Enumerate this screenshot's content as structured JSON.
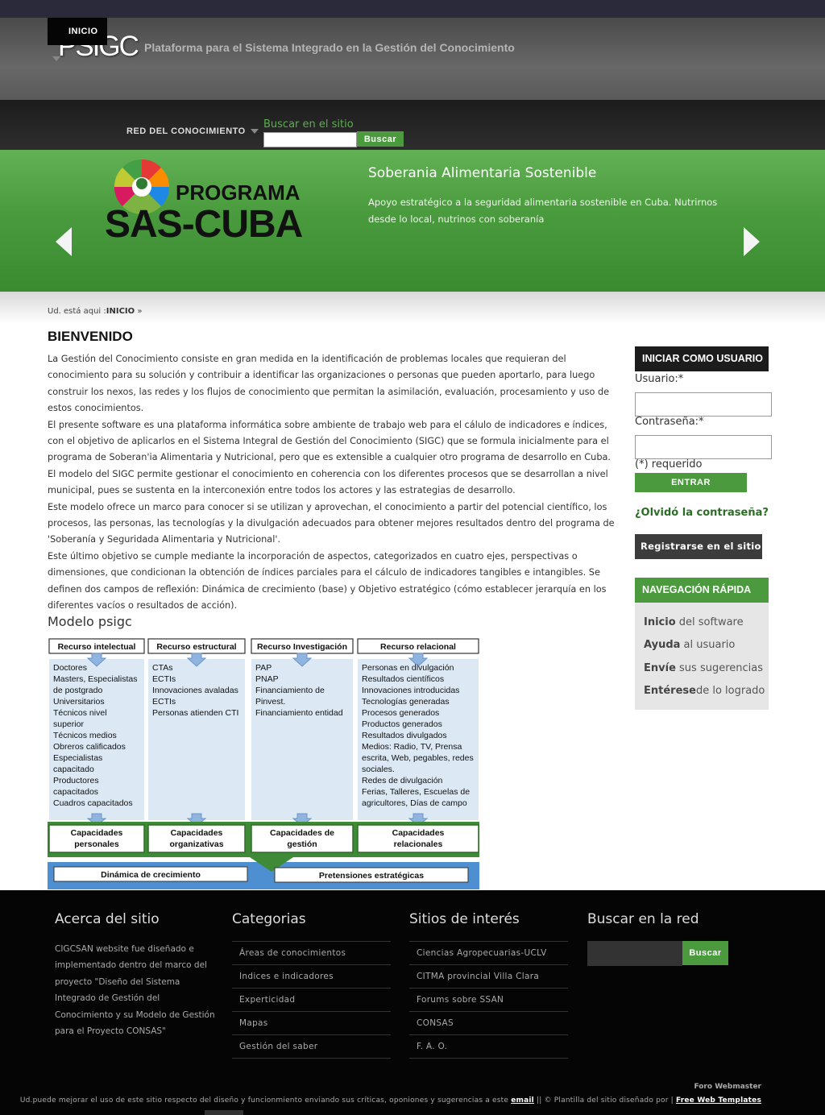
{
  "header": {
    "logo": "PSIGC",
    "tagline": "Plataforma para el Sistema Integrado en la Gestión del Conocimiento"
  },
  "nav": {
    "items": [
      {
        "label": "INICIO"
      },
      {
        "label": "RED DEL CONOCIMIENTO"
      }
    ],
    "search_label": "Buscar en el sitio",
    "search_value": "",
    "search_button": "Buscar"
  },
  "banner": {
    "logo_line1": "PROGRAMA",
    "logo_line2": "SAS-CUBA",
    "title": "Soberania Alimentaria Sostenible",
    "text": "Apoyo estratégico a la seguridad alimentaria sostenible en Cuba. Nutrirnos desde lo local, nutrinos con soberanía"
  },
  "breadcrumb": {
    "prefix": "Ud. está aqui :",
    "current": "INICIO",
    "suffix": " »"
  },
  "main": {
    "title": "BIENVENIDO",
    "paragraphs": [
      "La Gestión del Conocimiento consiste en gran medida en la identificación de problemas locales que requieran del conocimiento para su solución y contribuir a identificar las organizaciones o personas que pueden aportarlo, para luego construir los nexos, las redes y los flujos de conocimiento que permitan la asimilación, evaluación, procesamiento y uso de estos conocimientos.",
      "El presente software es una plataforma informática sobre ambiente de trabajo web para el cálulo de indicadores e índices, con el objetivo de aplicarlos en el Sistema Integral de Gestión del Conocimiento (SIGC) que se formula inicialmente para el programa de Soberan'ia Alimentaria y Nutricional, pero que es extensible a cualquier otro programa de desarrollo en Cuba.",
      "El modelo del SIGC permite gestionar el conocimiento en coherencia con los diferentes procesos que se desarrollan a nivel municipal, pues se sustenta en la interconexión entre todos los actores y las estrategias de desarrollo.",
      "Este modelo ofrece un marco para conocer si se utilizan y aprovechan, el conocimiento a partir del potencial científico, los procesos, las personas, las tecnologías y la divulgación adecuados para obtener mejores resultados dentro del programa de 'Soberanía y Seguridada Alimentaria y Nutricional'.",
      "Este último objetivo se cumple mediante la incorporación de aspectos, categorizados en cuatro ejes, perspectivas o dimensiones, que condicionan la obtención de índices parciales para el cálculo de indicadores tangibles e intangibles. Se definen dos campos de reflexión: Dinámica de crecimiento (base) y Objetivo estratégico (cómo establecer jerarquía en los diferentes vacíos o resultados de acción)."
    ],
    "model_title": "Modelo psigc"
  },
  "diagram": {
    "columns": [
      {
        "header": "Recurso intelectual",
        "items": [
          "Doctores",
          "Masters, Especialistas",
          "de postgrado",
          "Universitarios",
          "Técnicos nivel",
          "superior",
          "Técnicos medios",
          "Obreros calificados",
          "Especialistas",
          "capacitado",
          "Productores",
          "capacitados",
          "Cuadros capacitados"
        ],
        "footer": [
          "Capacidades",
          "personales"
        ]
      },
      {
        "header": "Recurso estructural",
        "items": [
          "CTAs",
          "ECTIs",
          "Innovaciones avaladas",
          "ECTIs",
          "Personas atienden CTI"
        ],
        "footer": [
          "Capacidades",
          "organizativas"
        ]
      },
      {
        "header": "Recurso Investigación",
        "items": [
          "PAP",
          "PNAP",
          "Financiamiento de",
          "Pinvest.",
          "Financiamiento entidad"
        ],
        "footer": [
          "Capacidades  de",
          "gestión"
        ]
      },
      {
        "header": "Recurso relacional",
        "items": [
          "Personas en divulgación",
          "Resultados científicos",
          "Innovaciones introducidas",
          "Tecnologías generadas",
          "Procesos generados",
          "Productos generados",
          "Resultados divulgados",
          "Medios: Radio, TV, Prensa",
          "escrita, Web, pegables, redes",
          "sociales.",
          "Redes de divulgación",
          "Ferias, Talleres, Escuelas de",
          "agricultores, Días de campo"
        ],
        "footer": [
          "Capacidades",
          "relacionales"
        ]
      }
    ],
    "bottom_left": "Dinámica de crecimiento",
    "bottom_right": "Pretensiones estratégicas"
  },
  "sidebar": {
    "login_title": "INICIAR COMO USUARIO",
    "user_label": "Usuario:*",
    "pass_label": "Contraseña:*",
    "required_note": "(*) requerido",
    "login_button": "ENTRAR",
    "forgot": "¿Olvidó la contraseña?",
    "register": "Registrarse en el sitio",
    "quicknav_title": "NAVEGACIÓN RÁPIDA",
    "quicknav": [
      {
        "bold": "Inicio",
        "rest": " del software"
      },
      {
        "bold": "Ayuda",
        "rest": " al usuario"
      },
      {
        "bold": "Envíe",
        "rest": " sus sugerencias"
      },
      {
        "bold": "Entérese",
        "rest": "de lo logrado"
      }
    ]
  },
  "footer": {
    "about_title": "Acerca del sitio",
    "about_text": "CIGCSAN website fue diseñado e implementado dentro del marco del proyecto \"Diseño del Sistema Integrado de Gestión del Conocimiento y su Modelo de Gestión para el Proyecto CONSAS\"",
    "categories_title": "Categorias",
    "categories": [
      "Áreas de conocimientos",
      "Indices e indicadores",
      "Experticidad",
      "Mapas",
      "Gestión del saber"
    ],
    "sites_title": "Sitios de interés",
    "sites": [
      "Ciencias Agropecuarias-UCLV",
      "CITMA provincial Villa Clara",
      "Forums sobre SSAN",
      "CONSAS",
      "F. A. O."
    ],
    "search_title": "Buscar en la red",
    "search_button": "Buscar",
    "webmaster": "Foro Webmaster",
    "copy_text": "Ud.puede mejorar el uso de este sitio respecto del diseño y funcionmiento enviando sus críticas, oponiones y sugerencias a este ",
    "copy_email": "email",
    "copy_mid": " || © Plantilla del sitio diseñado por | ",
    "copy_link": "Free Web Templates"
  },
  "colors": {
    "brand_green": "#4b9a3e",
    "header_dark": "#1c1c1c",
    "footer_bg": "#050505"
  }
}
